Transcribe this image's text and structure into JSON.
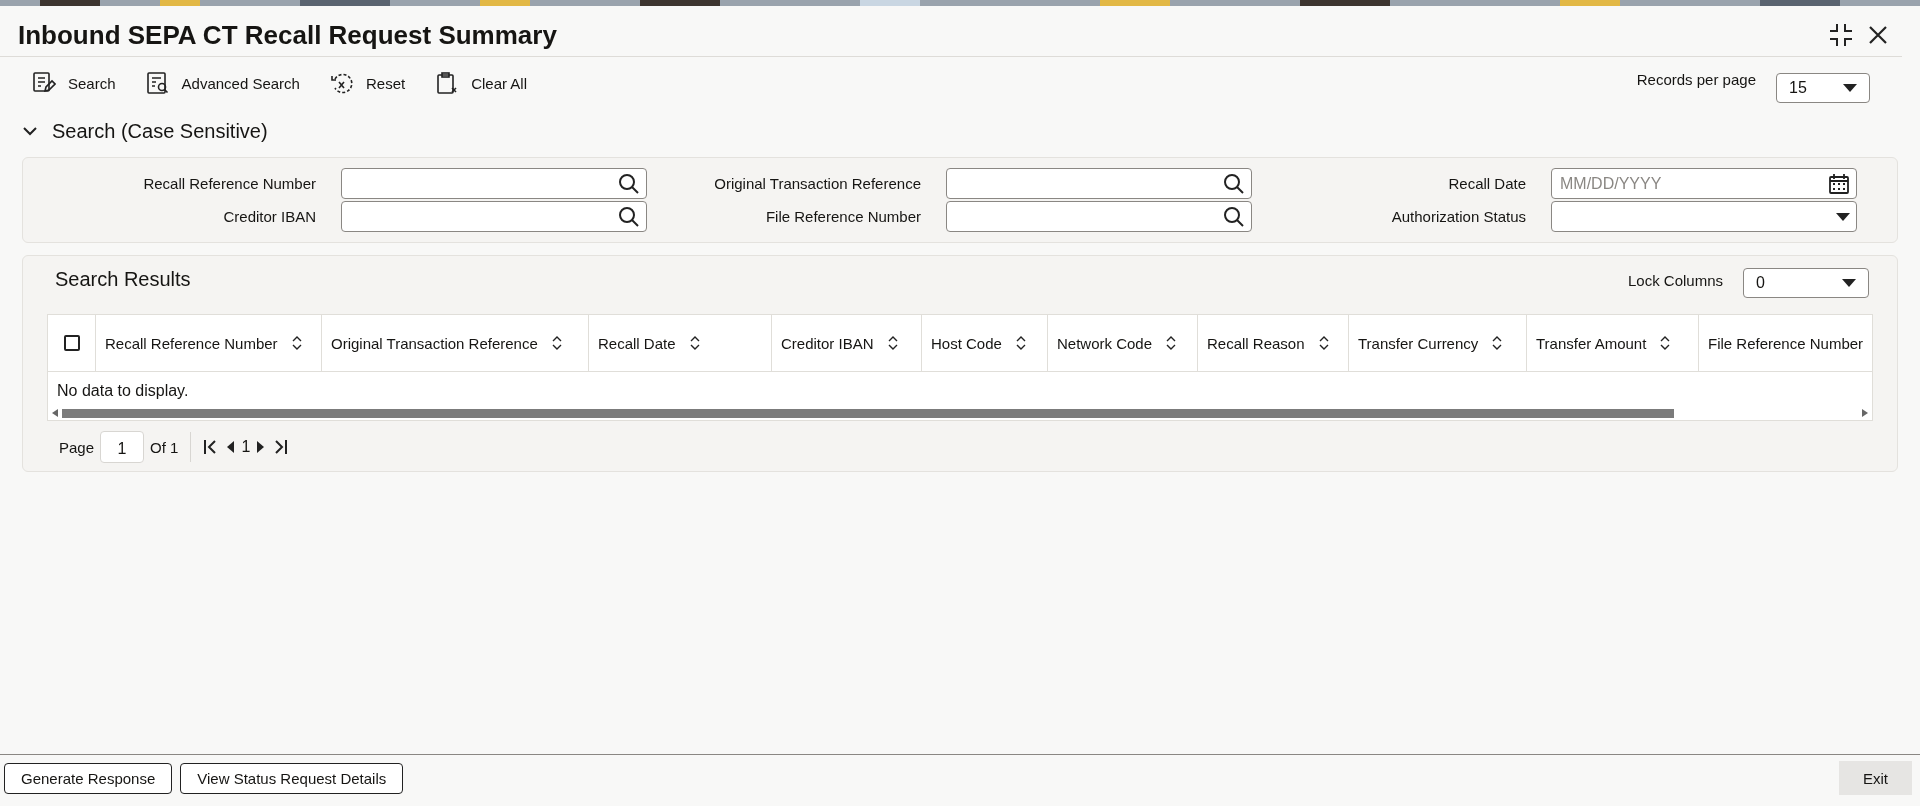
{
  "title": "Inbound SEPA CT Recall Request Summary",
  "toolbar": [
    {
      "label": "Search",
      "kind": "search"
    },
    {
      "label": "Advanced Search",
      "kind": "advanced"
    },
    {
      "label": "Reset",
      "kind": "reset"
    },
    {
      "label": "Clear All",
      "kind": "clear"
    }
  ],
  "records_per_page": {
    "label": "Records per page",
    "value": "15"
  },
  "search_section": {
    "title": "Search (Case Sensitive)",
    "expanded": true,
    "fields": [
      {
        "label": "Recall Reference Number",
        "kind": "lookup"
      },
      {
        "label": "Original Transaction Reference",
        "kind": "lookup"
      },
      {
        "label": "Recall Date",
        "kind": "date",
        "placeholder": "MM/DD/YYYY"
      },
      {
        "label": "Creditor IBAN",
        "kind": "lookup"
      },
      {
        "label": "File Reference Number",
        "kind": "lookup"
      },
      {
        "label": "Authorization Status",
        "kind": "select"
      }
    ]
  },
  "results": {
    "title": "Search Results",
    "lock_columns": {
      "label": "Lock Columns",
      "value": "0"
    },
    "select_all_checked": false,
    "columns": [
      {
        "label": "Recall Reference Number",
        "sortable": true
      },
      {
        "label": "Original Transaction Reference",
        "sortable": true
      },
      {
        "label": "Recall Date",
        "sortable": true
      },
      {
        "label": "Creditor IBAN",
        "sortable": true
      },
      {
        "label": "Host Code",
        "sortable": true
      },
      {
        "label": "Network Code",
        "sortable": true
      },
      {
        "label": "Recall Reason",
        "sortable": true
      },
      {
        "label": "Transfer Currency",
        "sortable": true
      },
      {
        "label": "Transfer Amount",
        "sortable": true
      },
      {
        "label": "File Reference Number",
        "sortable": false
      }
    ],
    "empty_message": "No data to display.",
    "pagination": {
      "page_label": "Page",
      "page": "1",
      "of_label": "Of 1",
      "current": "1"
    }
  },
  "footer": {
    "buttons": [
      "Generate Response",
      "View Status Request Details"
    ],
    "exit": "Exit"
  }
}
